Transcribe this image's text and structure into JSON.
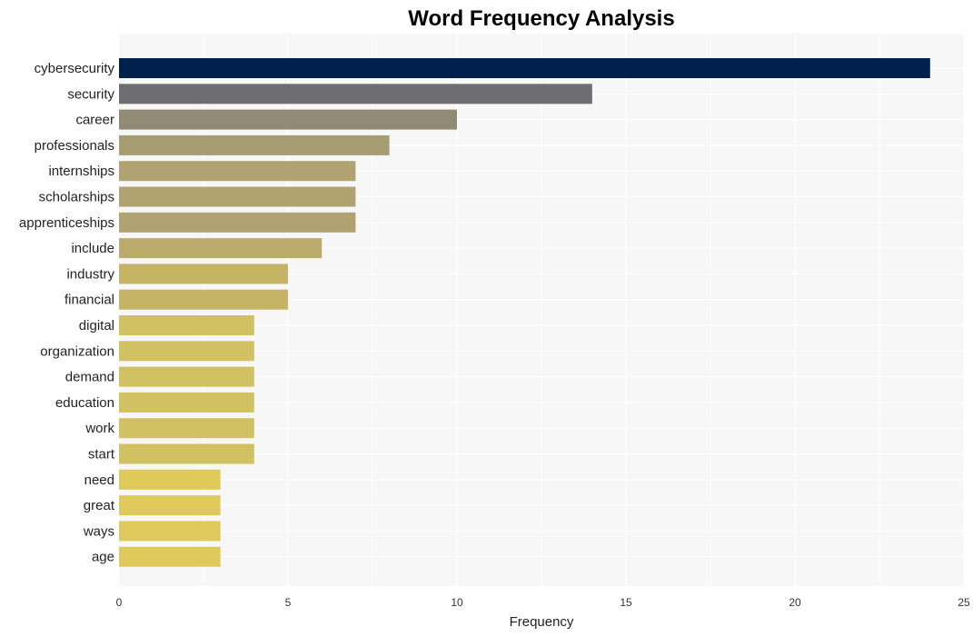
{
  "chart_data": {
    "type": "bar",
    "orientation": "horizontal",
    "title": "Word Frequency Analysis",
    "xlabel": "Frequency",
    "ylabel": "",
    "xlim": [
      0,
      25
    ],
    "xticks": [
      0,
      5,
      10,
      15,
      20,
      25
    ],
    "grid": true,
    "legend": "none",
    "categories": [
      "cybersecurity",
      "security",
      "career",
      "professionals",
      "internships",
      "scholarships",
      "apprenticeships",
      "include",
      "industry",
      "financial",
      "digital",
      "organization",
      "demand",
      "education",
      "work",
      "start",
      "need",
      "great",
      "ways",
      "age"
    ],
    "values": [
      24,
      14,
      10,
      8,
      7,
      7,
      7,
      6,
      5,
      5,
      4,
      4,
      4,
      4,
      4,
      4,
      3,
      3,
      3,
      3
    ],
    "colors": [
      "#00214d",
      "#6e6d70",
      "#918a75",
      "#a79d72",
      "#b0a371",
      "#b0a371",
      "#b0a371",
      "#bcac6c",
      "#c5b464",
      "#c5b464",
      "#d2c163",
      "#d2c163",
      "#d2c163",
      "#d2c163",
      "#d2c163",
      "#d2c163",
      "#dfc95b",
      "#dfc95b",
      "#dfc95b",
      "#dfc95b"
    ],
    "panel_background": "#f7f7f7",
    "grid_color": "#ffffff"
  }
}
